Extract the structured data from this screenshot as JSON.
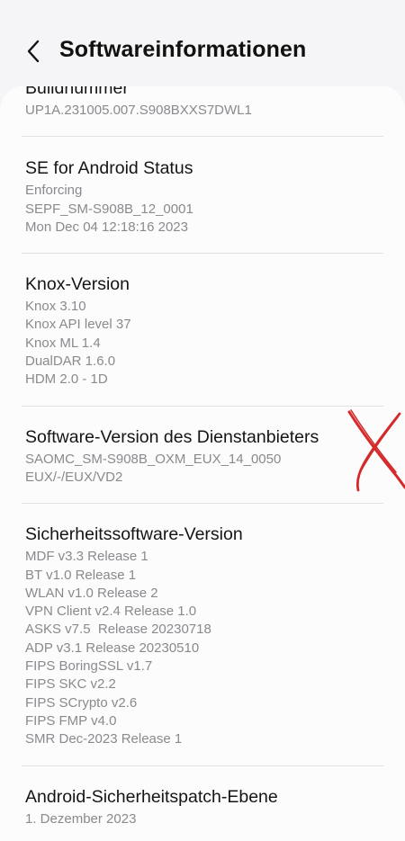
{
  "header": {
    "title": "Softwareinformationen",
    "back_icon": "chevron-left-icon"
  },
  "items": [
    {
      "title": "Buildnummer",
      "lines": [
        "UP1A.231005.007.S908BXXS7DWL1"
      ]
    },
    {
      "title": "SE for Android Status",
      "lines": [
        "Enforcing",
        "SEPF_SM-S908B_12_0001",
        "Mon Dec 04 12:18:16 2023"
      ]
    },
    {
      "title": "Knox-Version",
      "lines": [
        "Knox 3.10",
        "Knox API level 37",
        "Knox ML 1.4",
        "DualDAR 1.6.0",
        "HDM 2.0 - 1D"
      ]
    },
    {
      "title": "Software-Version des Dienstanbieters",
      "lines": [
        "SAOMC_SM-S908B_OXM_EUX_14_0050",
        "EUX/-/EUX/VD2"
      ]
    },
    {
      "title": "Sicherheitssoftware-Version",
      "lines": [
        "MDF v3.3 Release 1",
        "BT v1.0 Release 1",
        "WLAN v1.0 Release 2",
        "VPN Client v2.4 Release 1.0",
        "ASKS v7.5  Release 20230718",
        "ADP v3.1 Release 20230510",
        "FIPS BoringSSL v1.7",
        "FIPS SKC v2.2",
        "FIPS SCrypto v2.6",
        "FIPS FMP v4.0",
        "SMR Dec-2023 Release 1"
      ]
    },
    {
      "title": "Android-Sicherheitspatch-Ebene",
      "lines": [
        "1. Dezember 2023"
      ]
    }
  ],
  "annotation": {
    "icon": "red-x-mark-icon",
    "color": "#d42a2a"
  },
  "colors": {
    "background": "#f5f5f7",
    "card": "#fcfcfd",
    "title_text": "#151515",
    "secondary_text": "#8a8a8e",
    "divider": "#e1e1e4"
  }
}
